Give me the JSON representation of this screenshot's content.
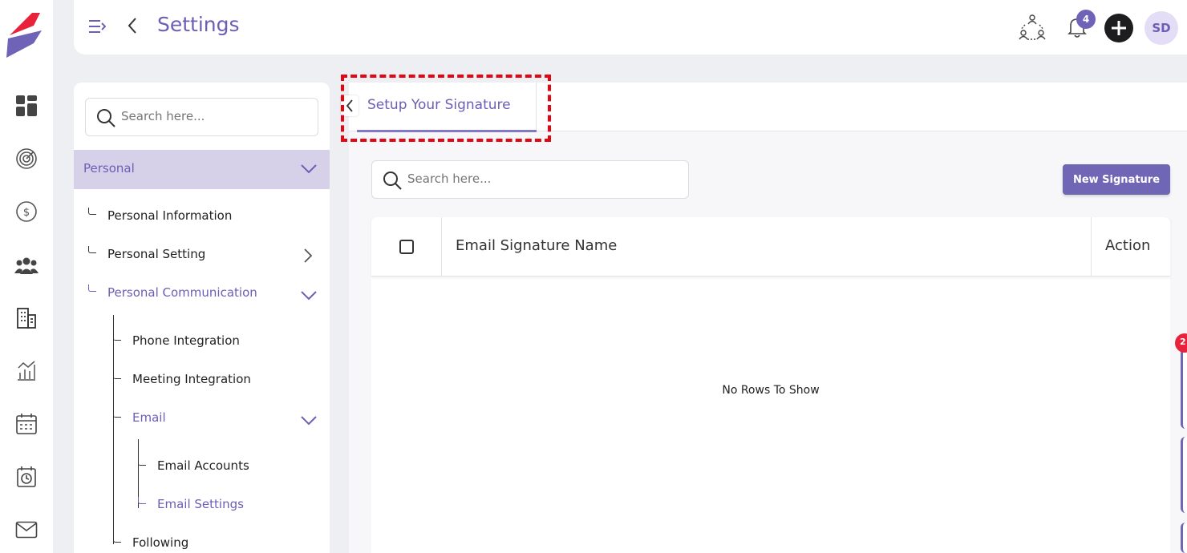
{
  "header": {
    "title": "Settings",
    "notification_count": "4",
    "avatar_initials": "SD"
  },
  "rail": {
    "icons": [
      "dashboard-icon",
      "target-icon",
      "dollar-icon",
      "users-icon",
      "building-icon",
      "chart-icon",
      "calendar-icon",
      "clock-icon",
      "mail-icon"
    ]
  },
  "sidepanel": {
    "search_placeholder": "Search here...",
    "section_label": "Personal",
    "items": {
      "personal_information": "Personal Information",
      "personal_setting": "Personal Setting",
      "personal_communication": "Personal Communication",
      "phone_integration": "Phone Integration",
      "meeting_integration": "Meeting Integration",
      "email": "Email",
      "email_accounts": "Email Accounts",
      "email_settings": "Email Settings",
      "following": "Following"
    }
  },
  "content": {
    "tab_label": "Setup Your Signature",
    "search_placeholder": "Search here...",
    "new_button": "New Signature",
    "columns": [
      "Email Signature Name",
      "Action"
    ],
    "empty_message": "No Rows To Show"
  },
  "edge": {
    "badge": "2"
  },
  "colors": {
    "accent": "#6b5fb5",
    "button": "#7066b6",
    "highlight": "#e30613",
    "section_bg": "#d6d1e9"
  }
}
